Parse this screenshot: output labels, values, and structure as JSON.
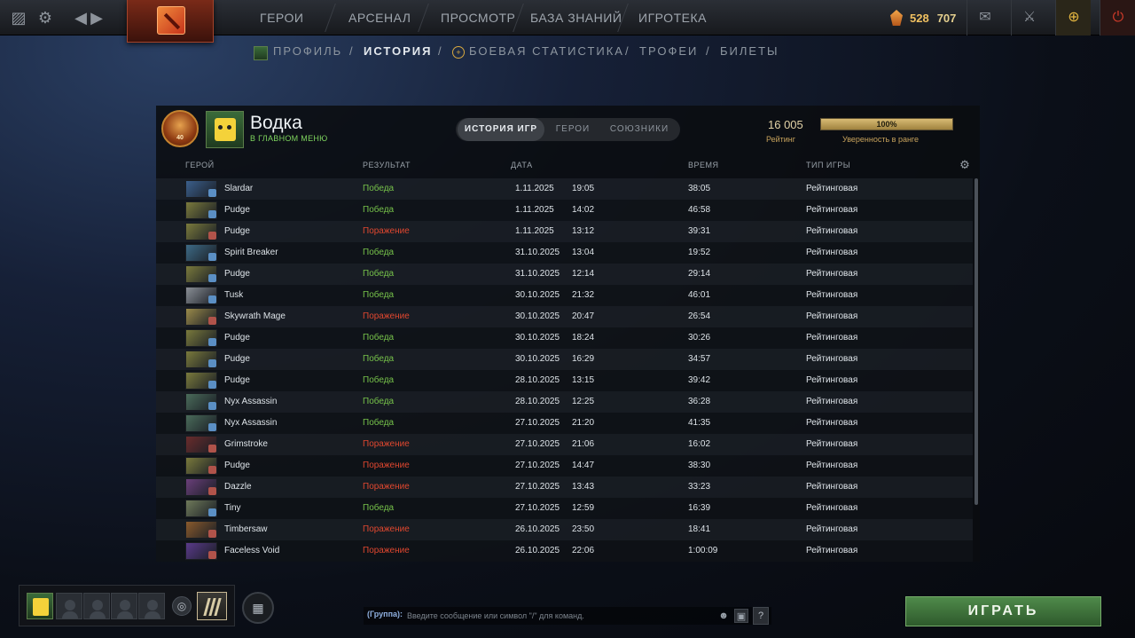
{
  "topbar": {
    "nav": [
      "ГЕРОИ",
      "АРСЕНАЛ",
      "ПРОСМОТР",
      "БАЗА ЗНАНИЙ",
      "ИГРОТЕКА"
    ],
    "currency_a": "528",
    "currency_b": "707"
  },
  "subnav": {
    "items": [
      "ПРОФИЛЬ",
      "ИСТОРИЯ",
      "БОЕВАЯ СТАТИСТИКА",
      "ТРОФЕИ",
      "БИЛЕТЫ"
    ],
    "active": "ИСТОРИЯ"
  },
  "profile": {
    "medal_level": "40",
    "name": "Водка",
    "status": "В ГЛАВНОМ МЕНЮ",
    "rating_value": "16 005",
    "rating_label": "Рейтинг",
    "confidence_value": "100%",
    "confidence_fraction": 1.0,
    "confidence_label": "Уверенность в ранге"
  },
  "tabs": [
    "ИСТОРИЯ ИГР",
    "ГЕРОИ",
    "СОЮЗНИКИ"
  ],
  "columns": {
    "hero": "ГЕРОЙ",
    "result": "РЕЗУЛЬТАТ",
    "date": "ДАТА",
    "duration": "ВРЕМЯ",
    "type": "ТИП ИГРЫ"
  },
  "matches": [
    {
      "hero": "Slardar",
      "result": "Победа",
      "win": true,
      "date": "1.11.2025",
      "time": "19:05",
      "duration": "38:05",
      "type": "Рейтинговая",
      "color": "#3b5f8c"
    },
    {
      "hero": "Pudge",
      "result": "Победа",
      "win": true,
      "date": "1.11.2025",
      "time": "14:02",
      "duration": "46:58",
      "type": "Рейтинговая",
      "color": "#7a7a3c"
    },
    {
      "hero": "Pudge",
      "result": "Поражение",
      "win": false,
      "date": "1.11.2025",
      "time": "13:12",
      "duration": "39:31",
      "type": "Рейтинговая",
      "color": "#7a7a3c"
    },
    {
      "hero": "Spirit Breaker",
      "result": "Победа",
      "win": true,
      "date": "31.10.2025",
      "time": "13:04",
      "duration": "19:52",
      "type": "Рейтинговая",
      "color": "#3d6a86"
    },
    {
      "hero": "Pudge",
      "result": "Победа",
      "win": true,
      "date": "31.10.2025",
      "time": "12:14",
      "duration": "29:14",
      "type": "Рейтинговая",
      "color": "#7a7a3c"
    },
    {
      "hero": "Tusk",
      "result": "Победа",
      "win": true,
      "date": "30.10.2025",
      "time": "21:32",
      "duration": "46:01",
      "type": "Рейтинговая",
      "color": "#8a8f96"
    },
    {
      "hero": "Skywrath Mage",
      "result": "Поражение",
      "win": false,
      "date": "30.10.2025",
      "time": "20:47",
      "duration": "26:54",
      "type": "Рейтинговая",
      "color": "#9a8a4a"
    },
    {
      "hero": "Pudge",
      "result": "Победа",
      "win": true,
      "date": "30.10.2025",
      "time": "18:24",
      "duration": "30:26",
      "type": "Рейтинговая",
      "color": "#7a7a3c"
    },
    {
      "hero": "Pudge",
      "result": "Победа",
      "win": true,
      "date": "30.10.2025",
      "time": "16:29",
      "duration": "34:57",
      "type": "Рейтинговая",
      "color": "#7a7a3c"
    },
    {
      "hero": "Pudge",
      "result": "Победа",
      "win": true,
      "date": "28.10.2025",
      "time": "13:15",
      "duration": "39:42",
      "type": "Рейтинговая",
      "color": "#7a7a3c"
    },
    {
      "hero": "Nyx Assassin",
      "result": "Победа",
      "win": true,
      "date": "28.10.2025",
      "time": "12:25",
      "duration": "36:28",
      "type": "Рейтинговая",
      "color": "#4a6b5a"
    },
    {
      "hero": "Nyx Assassin",
      "result": "Победа",
      "win": true,
      "date": "27.10.2025",
      "time": "21:20",
      "duration": "41:35",
      "type": "Рейтинговая",
      "color": "#4a6b5a"
    },
    {
      "hero": "Grimstroke",
      "result": "Поражение",
      "win": false,
      "date": "27.10.2025",
      "time": "21:06",
      "duration": "16:02",
      "type": "Рейтинговая",
      "color": "#6a2c2c"
    },
    {
      "hero": "Pudge",
      "result": "Поражение",
      "win": false,
      "date": "27.10.2025",
      "time": "14:47",
      "duration": "38:30",
      "type": "Рейтинговая",
      "color": "#7a7a3c"
    },
    {
      "hero": "Dazzle",
      "result": "Поражение",
      "win": false,
      "date": "27.10.2025",
      "time": "13:43",
      "duration": "33:23",
      "type": "Рейтинговая",
      "color": "#6a3f7a"
    },
    {
      "hero": "Tiny",
      "result": "Победа",
      "win": true,
      "date": "27.10.2025",
      "time": "12:59",
      "duration": "16:39",
      "type": "Рейтинговая",
      "color": "#6f7a5a"
    },
    {
      "hero": "Timbersaw",
      "result": "Поражение",
      "win": false,
      "date": "26.10.2025",
      "time": "23:50",
      "duration": "18:41",
      "type": "Рейтинговая",
      "color": "#8a5a2c"
    },
    {
      "hero": "Faceless Void",
      "result": "Поражение",
      "win": false,
      "date": "26.10.2025",
      "time": "22:06",
      "duration": "1:00:09",
      "type": "Рейтинговая",
      "color": "#5a3a8a"
    }
  ],
  "chat": {
    "group_label": "(Группа):",
    "placeholder": "Введите сообщение или символ \"/\" для команд."
  },
  "play_label": "ИГРАТЬ",
  "colors": {
    "win": "#76c24a",
    "loss": "#e0472f",
    "play": "#4f8a4a",
    "gold": "#c7a25c"
  },
  "icons": [
    "dashboard-icon",
    "gear-icon",
    "back-arrow-icon",
    "forward-arrow-icon",
    "dota-logo-icon",
    "shard-icon",
    "mail-icon",
    "armory-icon",
    "plus-badge-icon",
    "power-icon",
    "emoji-icon",
    "chat-wheel-icon",
    "help-icon",
    "group-icon",
    "voice-icon",
    "battle-pass-icon"
  ]
}
